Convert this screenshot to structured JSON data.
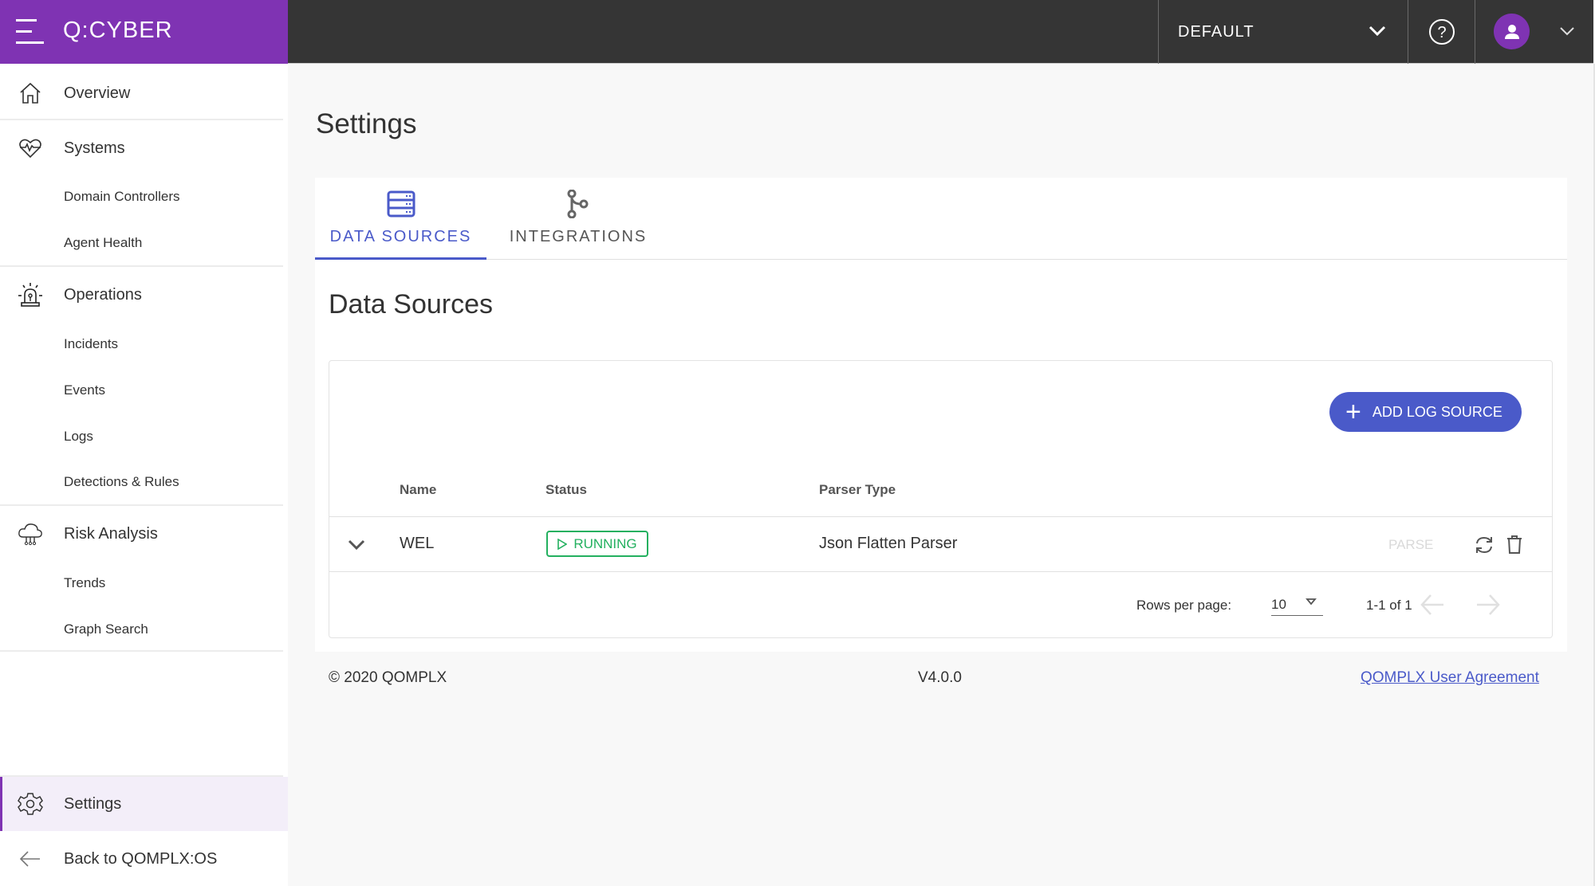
{
  "header": {
    "brand": "Q:CYBER",
    "tenant": "DEFAULT",
    "colors": {
      "brand": "#7f33b3",
      "topbar": "#353535",
      "accent": "#4a5ac9",
      "success": "#23b05f"
    }
  },
  "sidebar": {
    "sections": [
      {
        "label": "Overview",
        "icon": "home-icon",
        "items": []
      },
      {
        "label": "Systems",
        "icon": "heart-pulse-icon",
        "items": [
          "Domain Controllers",
          "Agent Health"
        ]
      },
      {
        "label": "Operations",
        "icon": "siren-icon",
        "items": [
          "Incidents",
          "Events",
          "Logs",
          "Detections & Rules"
        ]
      },
      {
        "label": "Risk Analysis",
        "icon": "cloud-network-icon",
        "items": [
          "Trends",
          "Graph Search"
        ]
      }
    ],
    "settings": "Settings",
    "back": "Back to QOMPLX:OS"
  },
  "page": {
    "title": "Settings",
    "tabs": [
      {
        "label": "DATA SOURCES",
        "icon": "server-icon",
        "active": true
      },
      {
        "label": "INTEGRATIONS",
        "icon": "branch-icon",
        "active": false
      }
    ],
    "section_title": "Data Sources",
    "add_button": "ADD LOG SOURCE",
    "table": {
      "columns": [
        "Name",
        "Status",
        "Parser Type"
      ],
      "rows": [
        {
          "name": "WEL",
          "status": "RUNNING",
          "parser_type": "Json Flatten Parser",
          "action": "PARSE"
        }
      ]
    },
    "pagination": {
      "rows_per_page_label": "Rows per page:",
      "rows_per_page": "10",
      "range": "1-1 of 1"
    }
  },
  "footer": {
    "copyright": "© 2020 QOMPLX",
    "version": "V4.0.0",
    "agreement_link": "QOMPLX User Agreement"
  }
}
